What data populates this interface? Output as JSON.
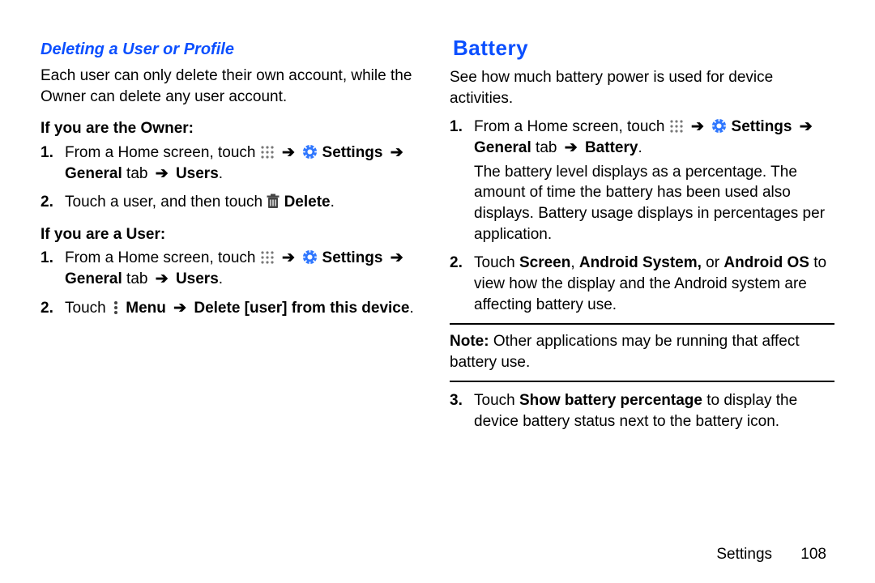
{
  "left": {
    "heading": "Deleting a User or Profile",
    "intro": "Each user can only delete their own account, while the Owner can delete any user account.",
    "ownerHeading": "If you are the Owner:",
    "owner1a": "From a Home screen, touch ",
    "settings_lbl": "Settings",
    "general_lbl": "General",
    "tab_lbl": " tab ",
    "users_lbl": "Users",
    "owner2a": "Touch a user, and then touch ",
    "delete_lbl": "Delete",
    "userHeading": "If you are a User:",
    "user1a": "From a Home screen, touch ",
    "user2a": "Touch ",
    "menu_lbl": "Menu",
    "delete_from_device": "Delete [user] from this device"
  },
  "right": {
    "heading": "Battery",
    "intro": "See how much battery power is used for device activities.",
    "step1a": "From a Home screen, touch ",
    "battery_lbl": "Battery",
    "step1_detail": "The battery level displays as a percentage. The amount of time the battery has been used also displays. Battery usage displays in percentages per application.",
    "step2a": "Touch ",
    "screen_lbl": "Screen",
    "android_system_lbl": "Android System,",
    "or_lbl": " or ",
    "android_os_lbl": "Android OS",
    "step2b": " to view how the display and the Android system are affecting battery use.",
    "note_label": "Note:",
    "note_body": " Other applications may be running that affect battery use.",
    "step3a": "Touch ",
    "show_batt_lbl": "Show battery percentage",
    "step3b": " to display the device battery status next to the battery icon."
  },
  "footer": {
    "section": "Settings",
    "page": "108"
  },
  "arrow": "➔"
}
